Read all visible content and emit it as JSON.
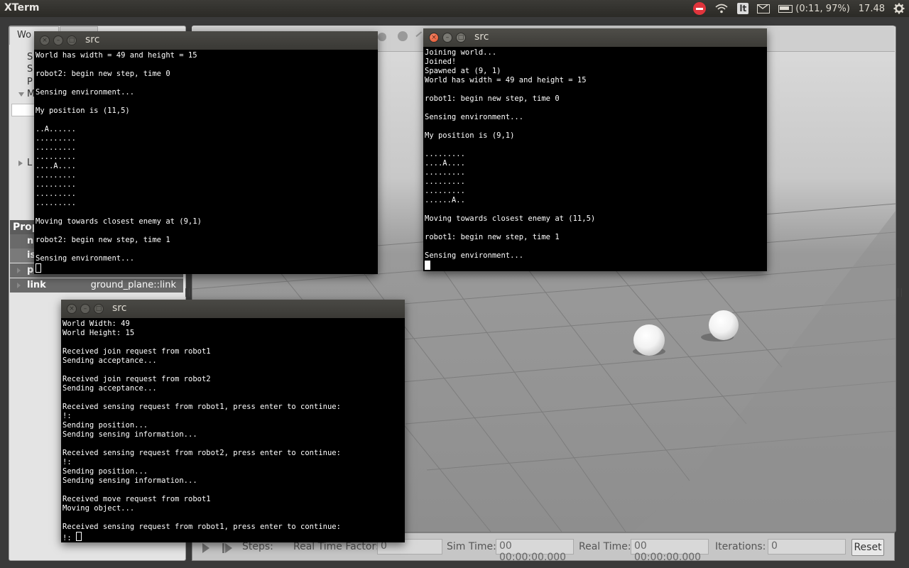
{
  "topbar": {
    "app_title": "XTerm",
    "keyboard_layout": "lt",
    "battery": "(0:11, 97%)",
    "clock": "17.48"
  },
  "gazebo": {
    "left_tab": "Wo",
    "left_items": [
      "S",
      "S",
      "P",
      "M",
      "L"
    ],
    "properties_title": "Prop",
    "property_rows": [
      {
        "key": "n",
        "value": ""
      },
      {
        "key": "is",
        "value": ""
      },
      {
        "key": "p",
        "value": ""
      },
      {
        "key": "link",
        "value": "ground_plane::link"
      }
    ],
    "bottom": {
      "steps_label": "Steps:",
      "rtf_label": "Real Time Factor:",
      "rtf_value": "0",
      "sim_time_label": "Sim Time:",
      "sim_time_value": "00 00:00:00.000",
      "real_time_label": "Real Time:",
      "real_time_value": "00 00:00:00.000",
      "iterations_label": "Iterations:",
      "iterations_value": "0",
      "reset_label": "Reset"
    }
  },
  "terminals": {
    "robot2": {
      "title": "src",
      "text": "World has width = 49 and height = 15\n\nrobot2: begin new step, time 0\n\nSensing environment...\n\nMy position is (11,5)\n\n..A......\n.........\n.........\n.........\n....A....\n.........\n.........\n.........\n.........\n\nMoving towards closest enemy at (9,1)\n\nrobot2: begin new step, time 1\n\nSensing environment...\n"
    },
    "robot1": {
      "title": "src",
      "text": "Joining world...\nJoined!\nSpawned at (9, 1)\nWorld has width = 49 and height = 15\n\nrobot1: begin new step, time 0\n\nSensing environment...\n\nMy position is (9,1)\n\n.........\n....A....\n.........\n.........\n.........\n......A..\n\nMoving towards closest enemy at (11,5)\n\nrobot1: begin new step, time 1\n\nSensing environment...\n"
    },
    "server": {
      "title": "src",
      "text": "World Width: 49\nWorld Height: 15\n\nReceived join request from robot1\nSending acceptance...\n\nReceived join request from robot2\nSending acceptance...\n\nReceived sensing request from robot1, press enter to continue:\n!:\nSending position...\nSending sensing information...\n\nReceived sensing request from robot2, press enter to continue:\n!:\nSending position...\nSending sensing information...\n\nReceived move request from robot1\nMoving object...\n\nReceived sensing request from robot1, press enter to continue:\n!: "
    }
  }
}
